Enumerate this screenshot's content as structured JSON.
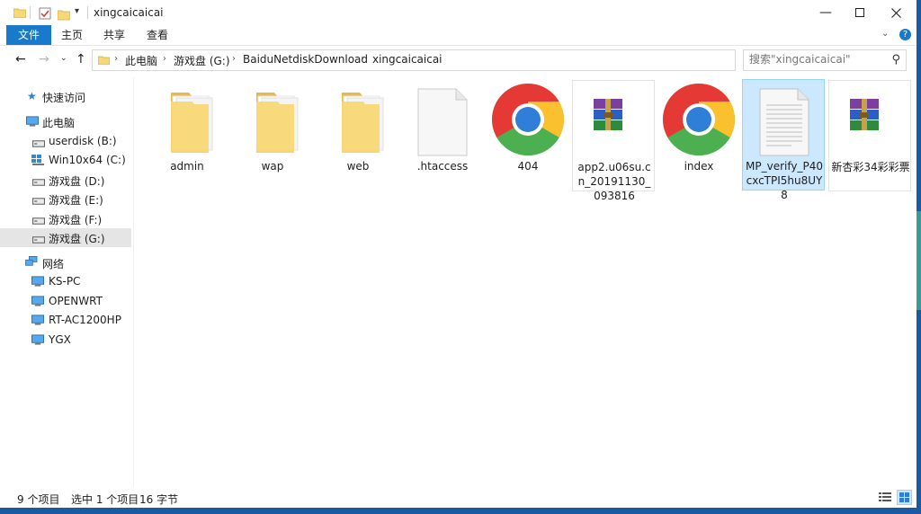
{
  "window": {
    "title": "xingcaicaicai",
    "minimize_icon": "minimize-icon",
    "maximize_icon": "maximize-icon",
    "close_icon": "close-icon"
  },
  "ribbon": {
    "tabs": [
      {
        "label": "文件"
      },
      {
        "label": "主页"
      },
      {
        "label": "共享"
      },
      {
        "label": "查看"
      }
    ],
    "help": "?"
  },
  "navigation": {
    "breadcrumbs": [
      "此电脑",
      "游戏盘 (G:)",
      "BaiduNetdiskDownload",
      "xingcaicaicai"
    ],
    "search_placeholder": "搜索\"xingcaicaicai\""
  },
  "sidebar": {
    "quick_access": "快速访问",
    "this_pc": "此电脑",
    "drives": [
      {
        "label": "userdisk (B:)"
      },
      {
        "label": "Win10x64 (C:)"
      },
      {
        "label": "游戏盘 (D:)"
      },
      {
        "label": "游戏盘 (E:)"
      },
      {
        "label": "游戏盘 (F:)"
      },
      {
        "label": "游戏盘 (G:)",
        "selected": true
      }
    ],
    "network": "网络",
    "network_items": [
      {
        "label": "KS-PC"
      },
      {
        "label": "OPENWRT"
      },
      {
        "label": "RT-AC1200HP"
      },
      {
        "label": "YGX"
      }
    ]
  },
  "files": [
    {
      "name": "admin",
      "type": "folder"
    },
    {
      "name": "wap",
      "type": "folder"
    },
    {
      "name": "web",
      "type": "folder"
    },
    {
      "name": ".htaccess",
      "type": "blank-file"
    },
    {
      "name": "404",
      "type": "chrome-html"
    },
    {
      "name": "app2.u06su.cn_20191130_093816",
      "type": "winrar-archive"
    },
    {
      "name": "index",
      "type": "chrome-html"
    },
    {
      "name": "MP_verify_P40cxcTPI5hu8UY8",
      "type": "text-file",
      "selected": true
    },
    {
      "name": "新杏彩34彩彩票",
      "type": "winrar-archive"
    }
  ],
  "status": {
    "item_count": "9 个项目",
    "selection": "选中 1 个项目",
    "size": "16 字节"
  },
  "colors": {
    "accent": "#1979ca",
    "selection_bg": "#cce8ff",
    "selection_border": "#99d1ff",
    "folder_yellow": "#f8d775",
    "frame_blue": "#1a5aa3"
  }
}
